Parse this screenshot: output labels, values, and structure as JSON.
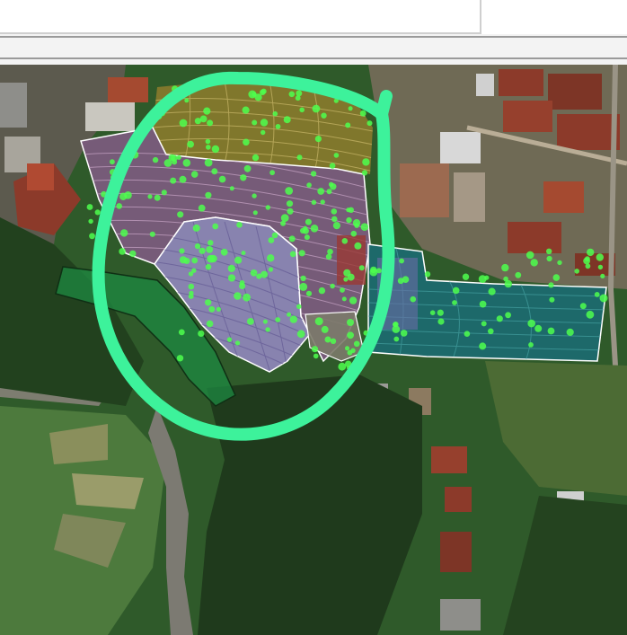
{
  "colors": {
    "vegetation_dark": "#1f3a1c",
    "vegetation": "#2f5a2a",
    "vegetation_light": "#4d7a3d",
    "roof_red": "#8c3a2a",
    "roof_grey": "#8e8e8a",
    "road": "#b9ad96",
    "terraces": "#8a8f5c",
    "parcel_olive": "#8a7a2c",
    "parcel_purple": "#7a5c7c",
    "parcel_lavender": "#8d86b6",
    "parcel_teal": "#1c6a70",
    "parcel_green": "#1e8a42",
    "point_green": "#4dff4d",
    "highlight_circle": "#3df29b",
    "boundary_white": "#ffffff"
  },
  "map": {
    "type": "satellite-imagery",
    "overlays": [
      "contour-lines",
      "survey-points",
      "land-parcels",
      "hand-drawn-highlight-circle"
    ],
    "parcels": [
      {
        "id": "parcel-olive",
        "color": "#8a7a2c"
      },
      {
        "id": "parcel-purple",
        "color": "#7a5c7c"
      },
      {
        "id": "parcel-lavender",
        "color": "#8d86b6"
      },
      {
        "id": "parcel-teal",
        "color": "#1c6a70"
      },
      {
        "id": "parcel-green",
        "color": "#1e8a42"
      }
    ]
  }
}
